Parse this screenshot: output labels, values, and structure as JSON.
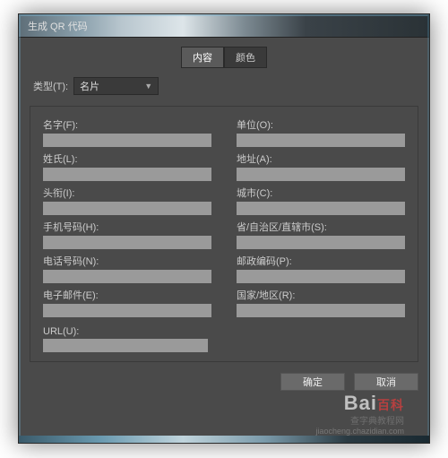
{
  "window": {
    "title": "生成 QR 代码"
  },
  "tabs": {
    "content": "内容",
    "color": "颜色"
  },
  "type": {
    "label": "类型(T):",
    "value": "名片"
  },
  "fields": {
    "left": {
      "name": "名字(F):",
      "lastname": "姓氏(L):",
      "title": "头衔(I):",
      "mobile": "手机号码(H):",
      "phone": "电话号码(N):",
      "email": "电子邮件(E):",
      "url": "URL(U):"
    },
    "right": {
      "org": "单位(O):",
      "address": "地址(A):",
      "city": "城市(C):",
      "state": "省/自治区/直辖市(S):",
      "postal": "邮政编码(P):",
      "country": "国家/地区(R):"
    }
  },
  "buttons": {
    "ok": "确定",
    "cancel": "取消"
  },
  "watermark": {
    "brand": "Bai",
    "brand2": "百科",
    "sub": "查字典教程网",
    "url": "jiaocheng.chazidian.com"
  }
}
